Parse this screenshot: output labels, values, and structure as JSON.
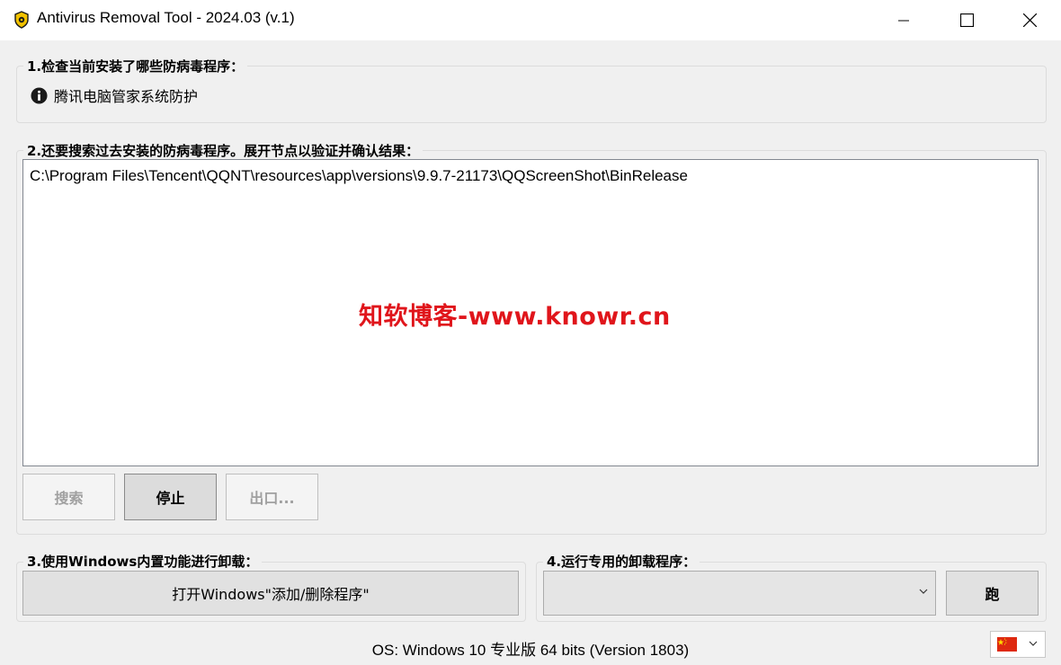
{
  "window": {
    "title": "Antivirus Removal Tool - 2024.03 (v.1)",
    "icon": "shield-icon",
    "controls": [
      "minimize-icon",
      "maximize-icon",
      "close-icon"
    ]
  },
  "section1": {
    "label": "1.检查当前安装了哪些防病毒程序：",
    "items": [
      {
        "icon": "info-icon",
        "text": "腾讯电脑管家系统防护"
      }
    ]
  },
  "section2": {
    "label": "2.还要搜索过去安装的防病毒程序。展开节点以验证并确认结果：",
    "results": [
      "C:\\Program Files\\Tencent\\QQNT\\resources\\app\\versions\\9.9.7-21173\\QQScreenShot\\BinRelease"
    ],
    "watermark": "知软博客-www.knowr.cn",
    "buttons": {
      "search": "搜索",
      "stop": "停止",
      "export": "出口..."
    }
  },
  "section3": {
    "label": "3.使用Windows内置功能进行卸载：",
    "button": "打开Windows\"添加/删除程序\""
  },
  "section4": {
    "label": "4.运行专用的卸载程序：",
    "select_value": "",
    "run_button": "跑"
  },
  "status": {
    "os_text": "OS: Windows 10 专业版 64 bits (Version 1803)"
  },
  "language": {
    "flag": "china-flag-icon"
  },
  "colors": {
    "accent_watermark": "#e0151b",
    "window_bg": "#f0f0f0"
  }
}
